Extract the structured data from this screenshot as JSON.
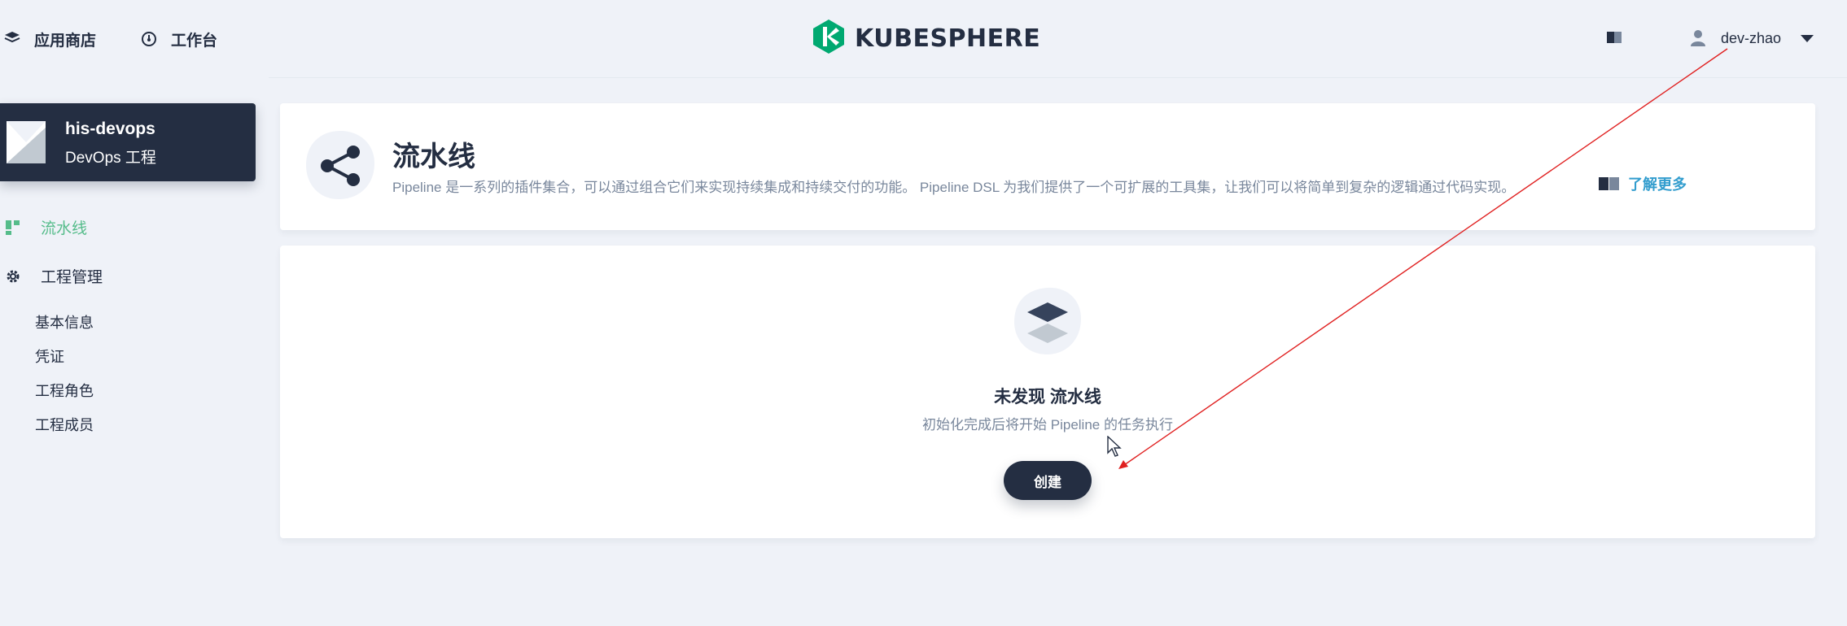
{
  "topbar": {
    "app_store": "应用商店",
    "workbench": "工作台",
    "logo_text": "KUBESPHERE",
    "username": "dev-zhao"
  },
  "sidebar": {
    "project_name": "his-devops",
    "project_type": "DevOps 工程",
    "menu": {
      "pipeline": "流水线",
      "project_mgmt": "工程管理",
      "sub_items": [
        "基本信息",
        "凭证",
        "工程角色",
        "工程成员"
      ]
    }
  },
  "header": {
    "title": "流水线",
    "description": "Pipeline 是一系列的插件集合，可以通过组合它们来实现持续集成和持续交付的功能。 Pipeline DSL 为我们提供了一个可扩展的工具集，让我们可以将简单到复杂的逻辑通过代码实现。",
    "learn_more": "了解更多"
  },
  "empty_state": {
    "title": "未发现 流水线",
    "description": "初始化完成后将开始 Pipeline 的任务执行",
    "create_label": "创建"
  },
  "colors": {
    "brand_dark": "#242e42",
    "accent_green": "#55bc8a",
    "link_blue": "#329dce",
    "annotation_red": "#e02020",
    "background": "#eff2f8"
  },
  "icons": [
    "appstore-icon",
    "workbench-icon",
    "kubesphere-logo-icon",
    "docs-icon",
    "user-icon",
    "caret-down-icon",
    "pipeline-icon",
    "gear-icon",
    "book-icon",
    "layers-icon",
    "mouse-cursor-icon"
  ]
}
